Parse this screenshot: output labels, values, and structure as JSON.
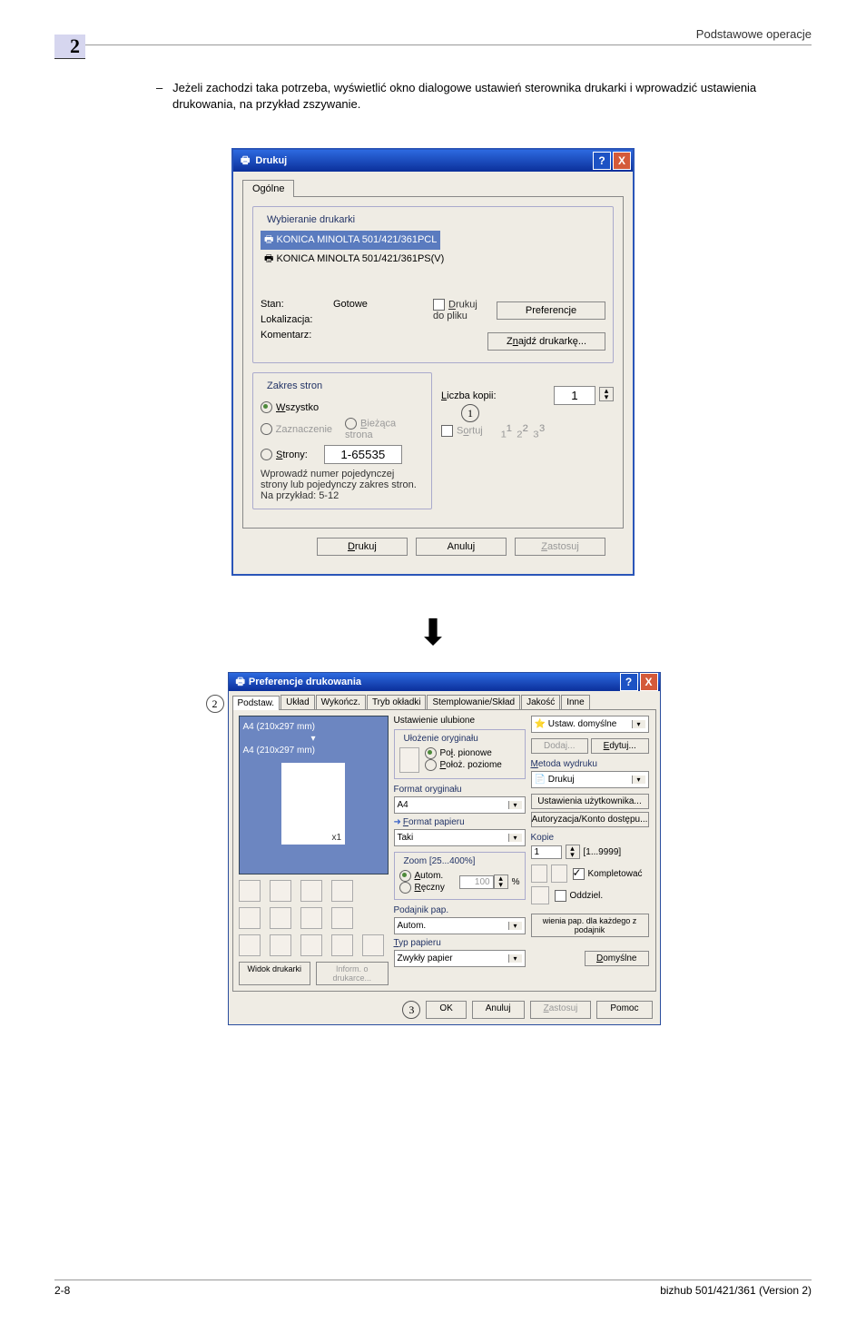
{
  "page": {
    "header_right": "Podstawowe operacje",
    "chapter": "2",
    "body_text": "Jeżeli zachodzi taka potrzeba, wyświetlić okno dialogowe ustawień sterownika drukarki i wprowadzić ustawienia drukowania, na przykład zszywanie.",
    "footer_left": "2-8",
    "footer_right": "bizhub 501/421/361 (Version 2)"
  },
  "callouts": {
    "c1": "1",
    "c2": "2",
    "c3": "3"
  },
  "print_dialog": {
    "title": "Drukuj",
    "tab_general": "Ogólne",
    "group_printer_legend": "Wybieranie drukarki",
    "printers": [
      "KONICA MINOLTA 501/421/361PCL",
      "KONICA MINOLTA 501/421/361PS(V)"
    ],
    "status_label": "Stan:",
    "status_value": "Gotowe",
    "location_label": "Lokalizacja:",
    "comment_label": "Komentarz:",
    "print_to_file": "Drukuj do pliku",
    "btn_prefs": "Preferencje",
    "btn_find": "Znajdź drukarkę...",
    "group_range_legend": "Zakres stron",
    "range_all": "Wszystko",
    "range_selection": "Zaznaczenie",
    "range_current": "Bieżąca strona",
    "range_pages": "Strony:",
    "range_pages_value": "1-65535",
    "range_hint": "Wprowadź numer pojedynczej strony lub pojedynczy zakres stron. Na przykład: 5-12",
    "copies_label": "Liczba kopii:",
    "copies_value": "1",
    "collate": "Sortuj",
    "btn_print": "Drukuj",
    "btn_cancel": "Anuluj",
    "btn_apply": "Zastosuj"
  },
  "prefs_dialog": {
    "title": "Preferencje drukowania",
    "tabs": {
      "t1": "Podstaw.",
      "t2": "Układ",
      "t3": "Wykończ.",
      "t4": "Tryb okładki",
      "t5": "Stemplowanie/Skład",
      "t6": "Jakość",
      "t7": "Inne"
    },
    "preview_a": "A4 (210x297 mm)",
    "preview_b": "A4 (210x297 mm)",
    "preview_btn_view": "Widok drukarki",
    "preview_btn_info": "Inform. o drukarce...",
    "fav_label": "Ustawienie ulubione",
    "fav_value": "Ustaw. domyślne",
    "fav_add": "Dodaj...",
    "fav_edit": "Edytuj...",
    "orient_legend": "Ułożenie oryginału",
    "orient_port": "Poł. pionowe",
    "orient_land": "Położ. poziome",
    "orig_size_label": "Format oryginału",
    "orig_size_value": "A4",
    "paper_size_label": "Format papieru",
    "paper_size_value": "Taki",
    "zoom_legend": "Zoom [25...400%]",
    "zoom_auto": "Autom.",
    "zoom_manual": "Ręczny",
    "zoom_value": "100",
    "percent": "%",
    "tray_label": "Podajnik pap.",
    "tray_value": "Autom.",
    "paper_type_label": "Typ papieru",
    "paper_type_value": "Zwykły papier",
    "method_label": "Metoda wydruku",
    "method_value": "Drukuj",
    "user_settings": "Ustawienia użytkownika...",
    "auth": "Autoryzacja/Konto dostępu...",
    "copies_label": "Kopie",
    "copies_value": "1",
    "copies_range": "[1...9999]",
    "collate": "Kompletować",
    "offset": "Oddziel.",
    "paper_per_tray": "wienia pap. dla każdego z podajnik",
    "defaults": "Domyślne",
    "ok": "OK",
    "cancel": "Anuluj",
    "apply": "Zastosuj",
    "help": "Pomoc"
  }
}
